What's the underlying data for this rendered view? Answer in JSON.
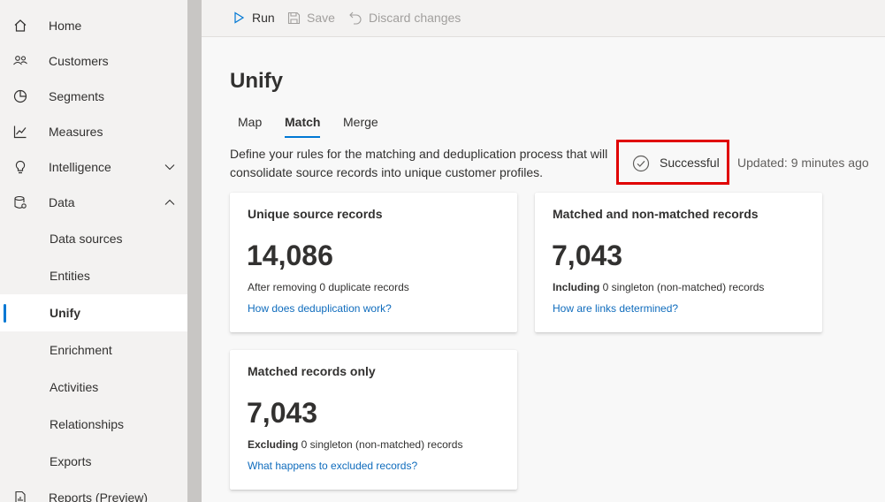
{
  "sidebar": {
    "items": [
      {
        "label": "Home",
        "icon": "home-icon"
      },
      {
        "label": "Customers",
        "icon": "customers-icon"
      },
      {
        "label": "Segments",
        "icon": "segments-icon"
      },
      {
        "label": "Measures",
        "icon": "measures-icon"
      },
      {
        "label": "Intelligence",
        "icon": "intelligence-icon"
      },
      {
        "label": "Data",
        "icon": "data-icon"
      }
    ],
    "data_subitems": [
      {
        "label": "Data sources"
      },
      {
        "label": "Entities"
      },
      {
        "label": "Unify"
      },
      {
        "label": "Enrichment"
      },
      {
        "label": "Activities"
      },
      {
        "label": "Relationships"
      },
      {
        "label": "Exports"
      }
    ],
    "reports_label": "Reports (Preview)",
    "active_item": "Unify"
  },
  "commandbar": {
    "run_label": "Run",
    "save_label": "Save",
    "discard_label": "Discard changes"
  },
  "page": {
    "title": "Unify",
    "tabs": [
      {
        "label": "Map"
      },
      {
        "label": "Match"
      },
      {
        "label": "Merge"
      }
    ],
    "active_tab": "Match",
    "description": "Define your rules for the matching and deduplication process that will consolidate source records into unique customer profiles.",
    "status": "Successful",
    "updated": "Updated: 9 minutes ago"
  },
  "cards": [
    {
      "title": "Unique source records",
      "value": "14,086",
      "note_prefix": "",
      "note": "After removing 0 duplicate records",
      "link": "How does deduplication work?"
    },
    {
      "title": "Matched and non-matched records",
      "value": "7,043",
      "note_prefix": "Including",
      "note": " 0 singleton (non-matched) records",
      "link": "How are links determined?"
    },
    {
      "title": "Matched records only",
      "value": "7,043",
      "note_prefix": "Excluding",
      "note": " 0 singleton (non-matched) records",
      "link": "What happens to excluded records?"
    }
  ],
  "colors": {
    "accent": "#0078d4",
    "highlight_border": "#e00000",
    "link": "#0f6cbd"
  }
}
